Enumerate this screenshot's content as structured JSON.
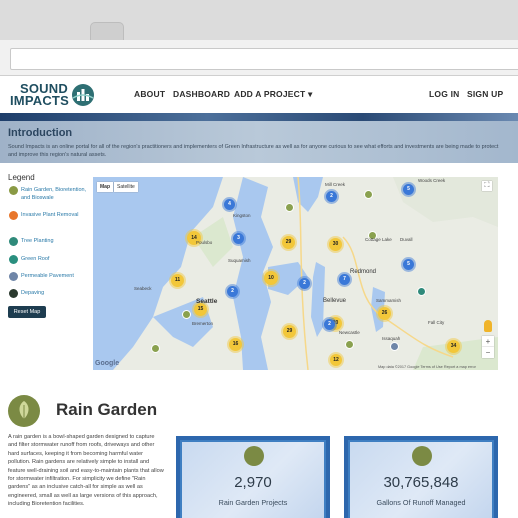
{
  "brand": {
    "line1": "SOUND",
    "line2": "IMPACTS"
  },
  "nav": {
    "about": "ABOUT",
    "dashboard": "DASHBOARD",
    "add_project": "ADD A PROJECT ▾",
    "login": "LOG IN",
    "signup": "SIGN UP"
  },
  "intro": {
    "title": "Introduction",
    "text": "Sound Impacts is an online portal for all of the region's practitioners and implementers of Green Infrastructure as well as for anyone curious to see what efforts and investments are being made to protect and improve this region's natural assets."
  },
  "legend": {
    "title": "Legend",
    "items": [
      {
        "label": "Rain Garden, Bioretention, and Bioswale",
        "color": "#8a9a45"
      },
      {
        "label": "Invasive Plant Removal",
        "color": "#e8762b"
      },
      {
        "label": "Tree Planting",
        "color": "#2f8a7a"
      },
      {
        "label": "Green Roof",
        "color": "#2a8f7f"
      },
      {
        "label": "Permeable Pavement",
        "color": "#6f86a8"
      },
      {
        "label": "Depaving",
        "color": "#2b3a2f"
      }
    ],
    "reset": "Reset Map"
  },
  "map": {
    "tabs": {
      "map": "Map",
      "satellite": "Satellite"
    },
    "labels": {
      "seattle": "Seattle",
      "bellevue": "Bellevue",
      "redmond": "Redmond",
      "kingston": "Kingston",
      "suquamish": "Suquamish",
      "bremerton": "Bremerton",
      "issaquah": "Issaquah",
      "newcastle": "Newcastle",
      "sammamish": "Sammamish",
      "seabeck": "Seabeck",
      "woodscreek": "Woods Creek",
      "millcreek": "Mill Creek",
      "fallcity": "Fall City",
      "duvall": "Duvall",
      "cottagelake": "Cottage Lake",
      "poulsbo": "Poulsbo"
    },
    "clusters_yellow": [
      "14",
      "29",
      "30",
      "11",
      "10",
      "15",
      "29",
      "16",
      "20",
      "26",
      "34",
      "12"
    ],
    "clusters_blue": [
      "5",
      "4",
      "2",
      "3",
      "2",
      "2",
      "7",
      "5",
      "2"
    ],
    "footer": "Map data ©2017 Google   Terms of Use   Report a map error",
    "google": "Google",
    "zoom_in": "+",
    "zoom_out": "−"
  },
  "section": {
    "title": "Rain Garden",
    "text": "A rain garden is a bowl-shaped garden designed to capture and filter stormwater runoff from roofs, driveways and other hard surfaces, keeping it from becoming harmful water pollution. Rain gardens are relatively simple to install and feature well-draining soil and easy-to-maintain plants that allow for stormwater infiltration. For simplicity we define \"Rain gardens\" as an inclusive catch-all for simple as well as engineered, small as well as large versions of this approach, including Bioretention facilities."
  },
  "stats": [
    {
      "number": "2,970",
      "label": "Rain Garden Projects"
    },
    {
      "number": "30,765,848",
      "label": "Gallons Of Runoff Managed"
    }
  ],
  "colors": {
    "navy": "#1f4e60",
    "accent_blue": "#3f7fc2",
    "leaf": "#7b8a44"
  }
}
